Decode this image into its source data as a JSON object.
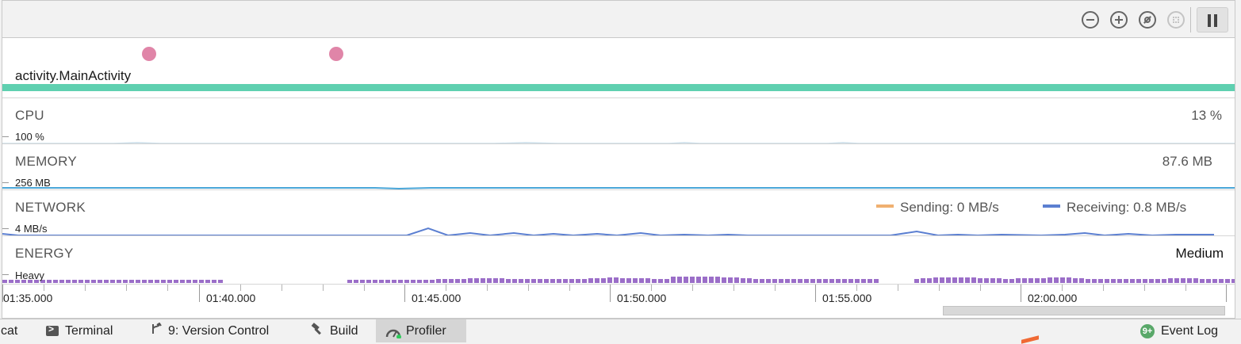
{
  "toolbar": {
    "icons": [
      "zoom-out-icon",
      "zoom-in-icon",
      "reset-zoom-icon",
      "zoom-to-selection-icon",
      "pause-icon"
    ]
  },
  "events": {
    "activity_label": "activity.MainActivity",
    "colors": {
      "event_dot": "#e085a8",
      "activity_bar": "#5fd0b0"
    }
  },
  "tracks": {
    "cpu": {
      "title": "CPU",
      "scale": "100 %",
      "value": "13 %",
      "line_color": "#c9dde9"
    },
    "memory": {
      "title": "MEMORY",
      "scale": "256 MB",
      "value": "87.6 MB",
      "line_color": "#4aa6d8"
    },
    "network": {
      "title": "NETWORK",
      "scale": "4 MB/s",
      "sending_label": "Sending: 0 MB/s",
      "receiving_label": "Receiving: 0.8 MB/s",
      "sending_color": "#f0b070",
      "receiving_color": "#5b7fd1"
    },
    "energy": {
      "title": "ENERGY",
      "scale": "Heavy",
      "value": "Medium",
      "bar_color": "#9b6ec8"
    }
  },
  "axis": {
    "labels": [
      "01:35.000",
      "01:40.000",
      "01:45.000",
      "01:50.000",
      "01:55.000",
      "02:00.000"
    ]
  },
  "bottom_tabs": [
    {
      "label": "cat",
      "active": false
    },
    {
      "label": "Terminal",
      "active": false
    },
    {
      "label": "9: Version Control",
      "active": false
    },
    {
      "label": "Build",
      "active": false
    },
    {
      "label": "Profiler",
      "active": true
    }
  ],
  "event_log": {
    "badge": "9+",
    "label": "Event Log",
    "badge_color": "#59a869"
  }
}
